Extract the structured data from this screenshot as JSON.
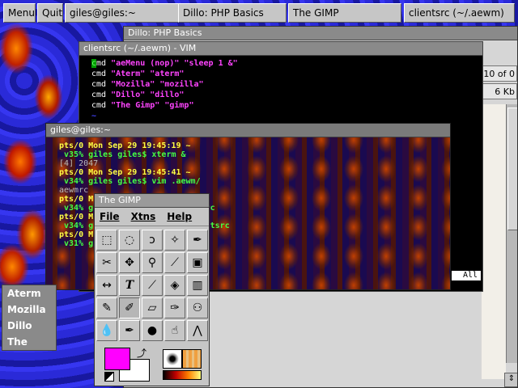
{
  "taskbar": {
    "menu": "Menu",
    "quit": "Quit",
    "tasks": [
      "giles@giles:~",
      "Dillo: PHP Basics",
      "The GIMP",
      "clientsrc (~/.aewm)"
    ]
  },
  "dillo": {
    "title": "Dillo: PHP Basics",
    "page_counter": "10 of 0",
    "size": "6 Kb"
  },
  "vim": {
    "title": "clientsrc (~/.aewm) - VIM",
    "lines": [
      {
        "cmd": "cmd",
        "a": "\"aeMenu (nop)\"",
        "b": "\"sleep 1 &\""
      },
      {
        "cmd": "cmd",
        "a": "\"Aterm\"",
        "b": "\"aterm\""
      },
      {
        "cmd": "cmd",
        "a": "\"Mozilla\"",
        "b": "\"mozilla\""
      },
      {
        "cmd": "cmd",
        "a": "\"Dillo\"",
        "b": "\"dillo\""
      },
      {
        "cmd": "cmd",
        "a": "\"The Gimp\"",
        "b": "\"gimp\""
      }
    ],
    "tilde": "~",
    "status": "All"
  },
  "terminal": {
    "title": "giles@giles:~",
    "lines": [
      {
        "t": "pts/0 Mon Sep 29 19:45:19 ~",
        "c": "yellow"
      },
      {
        "t": " v35% giles giles$ xterm &",
        "c": "green"
      },
      {
        "t": "[4] 2047",
        "c": "grey"
      },
      {
        "t": "pts/0 Mon Sep 29 19:45:41 ~",
        "c": "yellow"
      },
      {
        "t": " v34% giles giles$ vim .aewm/",
        "c": "green"
      },
      {
        "t": "aewmrc",
        "c": "grey"
      },
      {
        "t": "pts/0 M",
        "c": "yellow"
      },
      {
        "t": " v34% g                     wmrc",
        "c": "green"
      },
      {
        "t": "pts/0 M",
        "c": "yellow"
      },
      {
        "t": " v34% g                     ientsrc",
        "c": "green"
      },
      {
        "t": "pts/0 M",
        "c": "yellow"
      },
      {
        "t": " v31% g",
        "c": "green"
      }
    ]
  },
  "gimp": {
    "title": "The GIMP",
    "menus": [
      "File",
      "Xtns",
      "Help"
    ],
    "fg_color": "#ff00ff",
    "bg_color": "#ffffff"
  },
  "rootmenu": {
    "items": [
      "Aterm",
      "Mozilla",
      "Dillo",
      "The Gimp"
    ]
  }
}
